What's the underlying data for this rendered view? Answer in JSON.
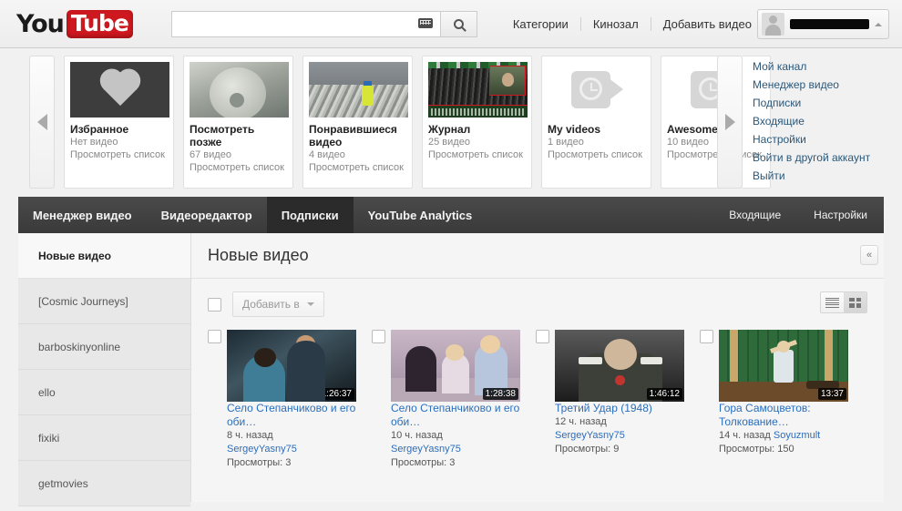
{
  "masthead": {
    "logo_you": "You",
    "logo_tube": "Tube",
    "search_placeholder": "",
    "search_value": "",
    "keyboard_icon": "keyboard-icon",
    "search_icon": "search-icon",
    "links": [
      "Категории",
      "Кинозал",
      "Добавить видео"
    ],
    "account": {
      "name_redacted": "",
      "avatar_icon": "user-avatar-icon",
      "caret_icon": "caret-up-icon"
    }
  },
  "carousel": {
    "prev_label": "◀",
    "next_label": "▶",
    "cards": [
      {
        "title": "Избранное",
        "count": "Нет видео",
        "link": "Просмотреть список",
        "art": "art-heart"
      },
      {
        "title": "Посмотреть позже",
        "count": "67 видео",
        "link": "Просмотреть список",
        "art": "art-baby"
      },
      {
        "title": "Понравившиеся видео",
        "count": "4 видео",
        "link": "Просмотреть список",
        "art": "art-recycle"
      },
      {
        "title": "Журнал",
        "count": "25 видео",
        "link": "Просмотреть список",
        "art": "art-news"
      },
      {
        "title": "My videos",
        "count": "1 видео",
        "link": "Просмотреть список",
        "art": "art-clock"
      },
      {
        "title": "Awesome",
        "count": "10 видео",
        "link": "Просмотреть список",
        "art": "art-clock"
      }
    ]
  },
  "account_links": [
    "Мой канал",
    "Менеджер видео",
    "Подписки",
    "Входящие",
    "Настройки",
    "Войти в другой аккаунт",
    "Выйти"
  ],
  "appbar": {
    "tabs": [
      {
        "label": "Менеджер видео",
        "active": false
      },
      {
        "label": "Видеоредактор",
        "active": false
      },
      {
        "label": "Подписки",
        "active": true
      },
      {
        "label": "YouTube Analytics",
        "active": false
      }
    ],
    "right_tabs": [
      "Входящие",
      "Настройки"
    ]
  },
  "sidebar": {
    "items": [
      {
        "label": "Новые видео",
        "active": true
      },
      {
        "label": "[Cosmic Journeys]",
        "active": false
      },
      {
        "label": "barboskinyonline",
        "active": false
      },
      {
        "label": "ello",
        "active": false
      },
      {
        "label": "fixiki",
        "active": false
      },
      {
        "label": "getmovies",
        "active": false
      }
    ]
  },
  "content": {
    "title": "Новые видео",
    "collapse_label": "«",
    "toolbar": {
      "select_all_checked": false,
      "add_to_label": "Добавить в",
      "caret_icon": "chevron-down-icon",
      "view_list_icon": "list-view-icon",
      "view_grid_icon": "grid-view-icon",
      "view_selected": "grid"
    },
    "videos": [
      {
        "title": "Село Степанчиково и его оби…",
        "duration": "1:26:37",
        "age": "8 ч. назад",
        "channel": "SergeyYasny75",
        "views": "Просмотры: 3",
        "art": "t1",
        "inline_channel": false
      },
      {
        "title": "Село Степанчиково и его оби…",
        "duration": "1:28:38",
        "age": "10 ч. назад",
        "channel": "SergeyYasny75",
        "views": "Просмотры: 3",
        "art": "t2",
        "inline_channel": false
      },
      {
        "title": "Третий Удар (1948)",
        "duration": "1:46:12",
        "age": "12 ч. назад",
        "channel": "SergeyYasny75",
        "views": "Просмотры: 9",
        "art": "t3",
        "inline_channel": false
      },
      {
        "title": "Гора Самоцветов: Толкование…",
        "duration": "13:37",
        "age": "14 ч. назад",
        "channel": "Soyuzmult",
        "views": "Просмотры: 150",
        "art": "t4",
        "inline_channel": true
      }
    ]
  },
  "colors": {
    "brand_red": "#cc181e",
    "link_blue": "#2b6ebb",
    "account_link_blue": "#2b587a",
    "appbar_dark": "#3a3a3a",
    "appbar_active": "#2b2b2b"
  }
}
